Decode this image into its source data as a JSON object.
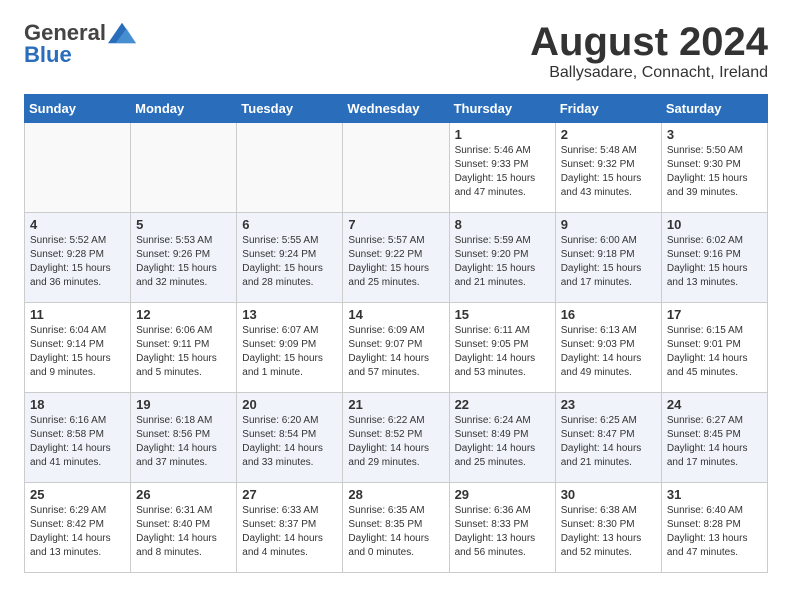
{
  "logo": {
    "general": "General",
    "blue": "Blue"
  },
  "title": "August 2024",
  "location": "Ballysadare, Connacht, Ireland",
  "days_of_week": [
    "Sunday",
    "Monday",
    "Tuesday",
    "Wednesday",
    "Thursday",
    "Friday",
    "Saturday"
  ],
  "weeks": [
    [
      {
        "day": "",
        "info": ""
      },
      {
        "day": "",
        "info": ""
      },
      {
        "day": "",
        "info": ""
      },
      {
        "day": "",
        "info": ""
      },
      {
        "day": "1",
        "info": "Sunrise: 5:46 AM\nSunset: 9:33 PM\nDaylight: 15 hours\nand 47 minutes."
      },
      {
        "day": "2",
        "info": "Sunrise: 5:48 AM\nSunset: 9:32 PM\nDaylight: 15 hours\nand 43 minutes."
      },
      {
        "day": "3",
        "info": "Sunrise: 5:50 AM\nSunset: 9:30 PM\nDaylight: 15 hours\nand 39 minutes."
      }
    ],
    [
      {
        "day": "4",
        "info": "Sunrise: 5:52 AM\nSunset: 9:28 PM\nDaylight: 15 hours\nand 36 minutes."
      },
      {
        "day": "5",
        "info": "Sunrise: 5:53 AM\nSunset: 9:26 PM\nDaylight: 15 hours\nand 32 minutes."
      },
      {
        "day": "6",
        "info": "Sunrise: 5:55 AM\nSunset: 9:24 PM\nDaylight: 15 hours\nand 28 minutes."
      },
      {
        "day": "7",
        "info": "Sunrise: 5:57 AM\nSunset: 9:22 PM\nDaylight: 15 hours\nand 25 minutes."
      },
      {
        "day": "8",
        "info": "Sunrise: 5:59 AM\nSunset: 9:20 PM\nDaylight: 15 hours\nand 21 minutes."
      },
      {
        "day": "9",
        "info": "Sunrise: 6:00 AM\nSunset: 9:18 PM\nDaylight: 15 hours\nand 17 minutes."
      },
      {
        "day": "10",
        "info": "Sunrise: 6:02 AM\nSunset: 9:16 PM\nDaylight: 15 hours\nand 13 minutes."
      }
    ],
    [
      {
        "day": "11",
        "info": "Sunrise: 6:04 AM\nSunset: 9:14 PM\nDaylight: 15 hours\nand 9 minutes."
      },
      {
        "day": "12",
        "info": "Sunrise: 6:06 AM\nSunset: 9:11 PM\nDaylight: 15 hours\nand 5 minutes."
      },
      {
        "day": "13",
        "info": "Sunrise: 6:07 AM\nSunset: 9:09 PM\nDaylight: 15 hours\nand 1 minute."
      },
      {
        "day": "14",
        "info": "Sunrise: 6:09 AM\nSunset: 9:07 PM\nDaylight: 14 hours\nand 57 minutes."
      },
      {
        "day": "15",
        "info": "Sunrise: 6:11 AM\nSunset: 9:05 PM\nDaylight: 14 hours\nand 53 minutes."
      },
      {
        "day": "16",
        "info": "Sunrise: 6:13 AM\nSunset: 9:03 PM\nDaylight: 14 hours\nand 49 minutes."
      },
      {
        "day": "17",
        "info": "Sunrise: 6:15 AM\nSunset: 9:01 PM\nDaylight: 14 hours\nand 45 minutes."
      }
    ],
    [
      {
        "day": "18",
        "info": "Sunrise: 6:16 AM\nSunset: 8:58 PM\nDaylight: 14 hours\nand 41 minutes."
      },
      {
        "day": "19",
        "info": "Sunrise: 6:18 AM\nSunset: 8:56 PM\nDaylight: 14 hours\nand 37 minutes."
      },
      {
        "day": "20",
        "info": "Sunrise: 6:20 AM\nSunset: 8:54 PM\nDaylight: 14 hours\nand 33 minutes."
      },
      {
        "day": "21",
        "info": "Sunrise: 6:22 AM\nSunset: 8:52 PM\nDaylight: 14 hours\nand 29 minutes."
      },
      {
        "day": "22",
        "info": "Sunrise: 6:24 AM\nSunset: 8:49 PM\nDaylight: 14 hours\nand 25 minutes."
      },
      {
        "day": "23",
        "info": "Sunrise: 6:25 AM\nSunset: 8:47 PM\nDaylight: 14 hours\nand 21 minutes."
      },
      {
        "day": "24",
        "info": "Sunrise: 6:27 AM\nSunset: 8:45 PM\nDaylight: 14 hours\nand 17 minutes."
      }
    ],
    [
      {
        "day": "25",
        "info": "Sunrise: 6:29 AM\nSunset: 8:42 PM\nDaylight: 14 hours\nand 13 minutes."
      },
      {
        "day": "26",
        "info": "Sunrise: 6:31 AM\nSunset: 8:40 PM\nDaylight: 14 hours\nand 8 minutes."
      },
      {
        "day": "27",
        "info": "Sunrise: 6:33 AM\nSunset: 8:37 PM\nDaylight: 14 hours\nand 4 minutes."
      },
      {
        "day": "28",
        "info": "Sunrise: 6:35 AM\nSunset: 8:35 PM\nDaylight: 14 hours\nand 0 minutes."
      },
      {
        "day": "29",
        "info": "Sunrise: 6:36 AM\nSunset: 8:33 PM\nDaylight: 13 hours\nand 56 minutes."
      },
      {
        "day": "30",
        "info": "Sunrise: 6:38 AM\nSunset: 8:30 PM\nDaylight: 13 hours\nand 52 minutes."
      },
      {
        "day": "31",
        "info": "Sunrise: 6:40 AM\nSunset: 8:28 PM\nDaylight: 13 hours\nand 47 minutes."
      }
    ]
  ],
  "colors": {
    "header_bg": "#2a6ebb",
    "header_text": "#ffffff",
    "alt_row": "#eef3fb"
  }
}
